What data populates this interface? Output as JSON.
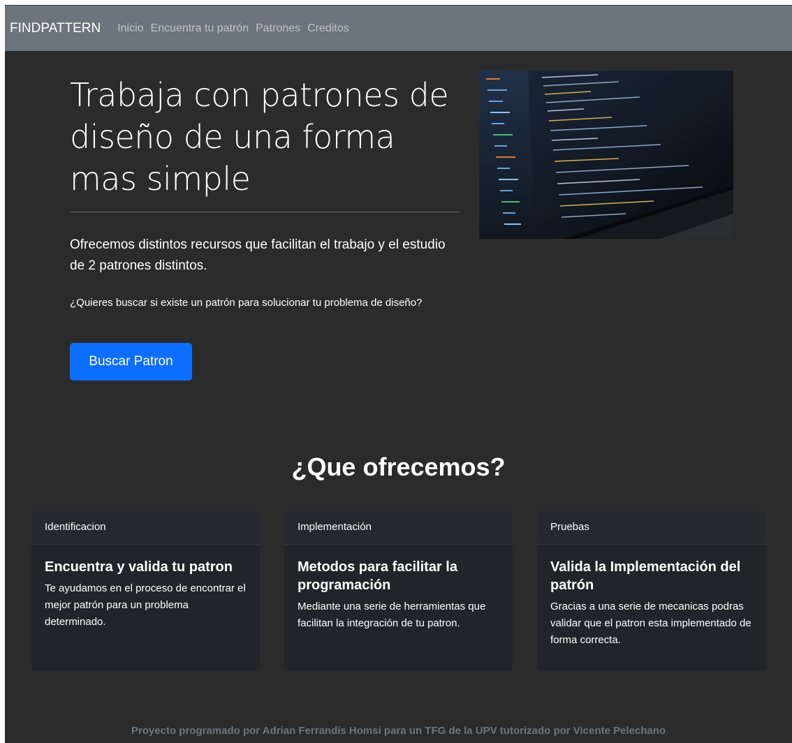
{
  "navbar": {
    "brand": "FINDPATTERN",
    "links": [
      "Inicio",
      "Encuentra tu patrón",
      "Patrones",
      "Creditos"
    ]
  },
  "hero": {
    "title": "Trabaja con patrones de diseño de una forma mas simple",
    "lead": "Ofrecemos distintos recursos que facilitan el trabajo y el estudio de 2 patrones distintos.",
    "question": "¿Quieres buscar si existe un patrón para solucionar tu problema de diseño?",
    "button_label": "Buscar Patron",
    "image_icon": "laptop-code-photo"
  },
  "features": {
    "title": "¿Que ofrecemos?",
    "cards": [
      {
        "header": "Identificacion",
        "title": "Encuentra y valida tu patron",
        "text": "Te ayudamos en el proceso de encontrar el mejor patrón para un problema determinado."
      },
      {
        "header": "Implementación",
        "title": "Metodos para facilitar la programación",
        "text": "Mediante una serie de herramientas que facilitan la integración de tu patron."
      },
      {
        "header": "Pruebas",
        "title": "Valida la Implementación del patrón",
        "text": "Gracias a una serie de mecanicas podras validar que el patron esta implementado de forma correcta."
      }
    ]
  },
  "footer": {
    "text": "Proyecto programado por Adrian Ferrandis Homsi para un TFG de la UPV tutorizado por Vicente Pelechano"
  },
  "colors": {
    "navbar": "#6c757d",
    "background": "#2b2b2b",
    "primary": "#0d6efd",
    "card": "#212529"
  }
}
